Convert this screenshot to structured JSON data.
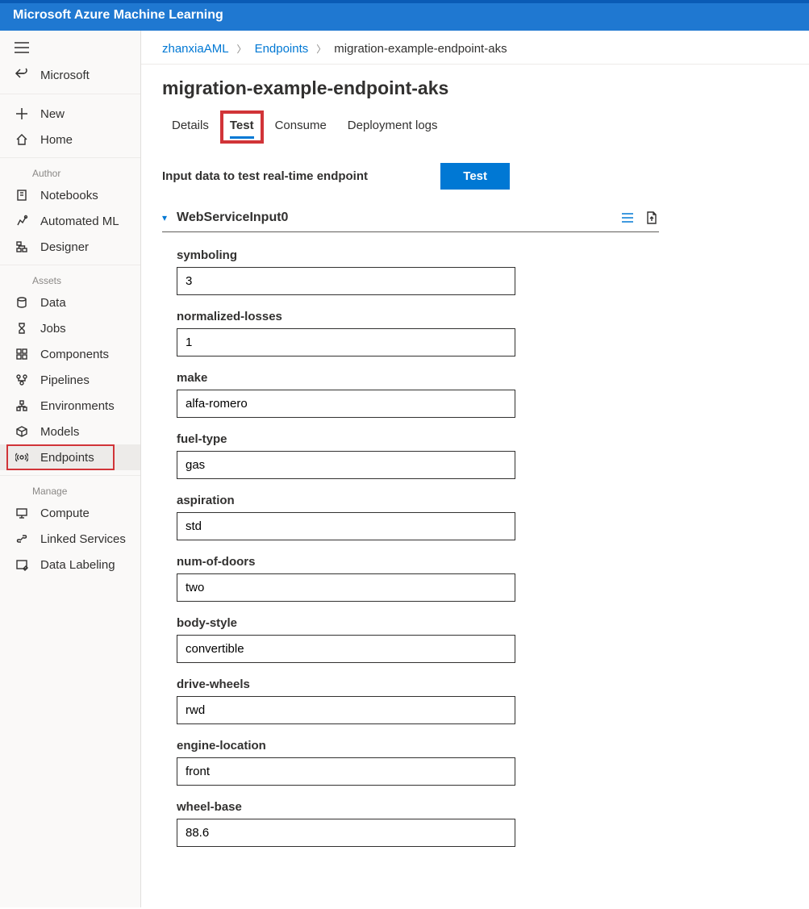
{
  "product": "Microsoft Azure Machine Learning",
  "workspace": "Microsoft",
  "sidebar": {
    "new": "New",
    "home": "Home",
    "sections": {
      "author": {
        "label": "Author",
        "items": [
          {
            "id": "notebooks",
            "label": "Notebooks"
          },
          {
            "id": "automl",
            "label": "Automated ML"
          },
          {
            "id": "designer",
            "label": "Designer"
          }
        ]
      },
      "assets": {
        "label": "Assets",
        "items": [
          {
            "id": "data",
            "label": "Data"
          },
          {
            "id": "jobs",
            "label": "Jobs"
          },
          {
            "id": "components",
            "label": "Components"
          },
          {
            "id": "pipelines",
            "label": "Pipelines"
          },
          {
            "id": "environments",
            "label": "Environments"
          },
          {
            "id": "models",
            "label": "Models"
          },
          {
            "id": "endpoints",
            "label": "Endpoints",
            "selected": true
          }
        ]
      },
      "manage": {
        "label": "Manage",
        "items": [
          {
            "id": "compute",
            "label": "Compute"
          },
          {
            "id": "linked",
            "label": "Linked Services"
          },
          {
            "id": "labeling",
            "label": "Data Labeling"
          }
        ]
      }
    }
  },
  "breadcrumbs": [
    {
      "label": "zhanxiaAML",
      "link": true
    },
    {
      "label": "Endpoints",
      "link": true
    },
    {
      "label": "migration-example-endpoint-aks",
      "link": false
    }
  ],
  "page_title": "migration-example-endpoint-aks",
  "tabs": [
    {
      "id": "details",
      "label": "Details"
    },
    {
      "id": "test",
      "label": "Test",
      "active": true
    },
    {
      "id": "consume",
      "label": "Consume"
    },
    {
      "id": "logs",
      "label": "Deployment logs"
    }
  ],
  "test": {
    "header": "Input data to test real-time endpoint",
    "button": "Test",
    "input_group": "WebServiceInput0",
    "fields": [
      {
        "name": "symboling",
        "value": "3"
      },
      {
        "name": "normalized-losses",
        "value": "1"
      },
      {
        "name": "make",
        "value": "alfa-romero"
      },
      {
        "name": "fuel-type",
        "value": "gas"
      },
      {
        "name": "aspiration",
        "value": "std"
      },
      {
        "name": "num-of-doors",
        "value": "two"
      },
      {
        "name": "body-style",
        "value": "convertible"
      },
      {
        "name": "drive-wheels",
        "value": "rwd"
      },
      {
        "name": "engine-location",
        "value": "front"
      },
      {
        "name": "wheel-base",
        "value": "88.6"
      }
    ]
  }
}
